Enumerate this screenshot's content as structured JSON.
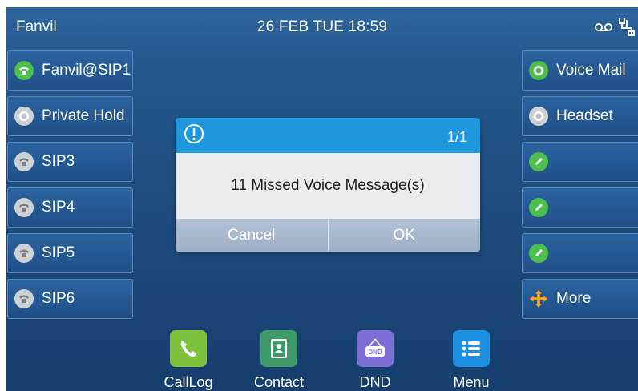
{
  "statusbar": {
    "brand": "Fanvil",
    "datetime": "26 FEB TUE  18:59",
    "icons": [
      "voicemail-icon",
      "network-icon"
    ]
  },
  "left_keys": [
    {
      "label": "Fanvil@SIP1",
      "icon": "phone-registered-icon",
      "state": "registered",
      "color": "#4cbf4f"
    },
    {
      "label": "Private Hold",
      "icon": "private-hold-icon",
      "state": "idle",
      "color": "#cfd2d5"
    },
    {
      "label": "SIP3",
      "icon": "phone-unregistered-icon",
      "state": "unregistered",
      "color": "#cfd2d5"
    },
    {
      "label": "SIP4",
      "icon": "phone-unregistered-icon",
      "state": "unregistered",
      "color": "#cfd2d5"
    },
    {
      "label": "SIP5",
      "icon": "phone-unregistered-icon",
      "state": "unregistered",
      "color": "#cfd2d5"
    },
    {
      "label": "SIP6",
      "icon": "phone-unregistered-icon",
      "state": "unregistered",
      "color": "#cfd2d5"
    }
  ],
  "right_keys": [
    {
      "label": "Voice Mail",
      "icon": "voicemail-key-icon",
      "color": "#4cbf4f"
    },
    {
      "label": "Headset",
      "icon": "headset-key-icon",
      "color": "#cfd2d5"
    },
    {
      "label": "",
      "icon": "edit-icon",
      "color": "#4cbf4f"
    },
    {
      "label": "",
      "icon": "edit-icon",
      "color": "#4cbf4f"
    },
    {
      "label": "",
      "icon": "edit-icon",
      "color": "#4cbf4f"
    },
    {
      "label": "More",
      "icon": "more-arrows-icon",
      "color": "#f5a623"
    }
  ],
  "dialog": {
    "page": "1/1",
    "message": "11 Missed Voice Message(s)",
    "cancel_label": "Cancel",
    "ok_label": "OK",
    "header_color": "#1f97dc"
  },
  "softkeys": [
    {
      "label": "CallLog",
      "icon": "call-log-icon",
      "color": "#7cc23f"
    },
    {
      "label": "Contact",
      "icon": "contact-icon",
      "color": "#3f9a6a"
    },
    {
      "label": "DND",
      "icon": "dnd-icon",
      "color": "#7e6fd6"
    },
    {
      "label": "Menu",
      "icon": "menu-icon",
      "color": "#1b8fe0"
    }
  ]
}
